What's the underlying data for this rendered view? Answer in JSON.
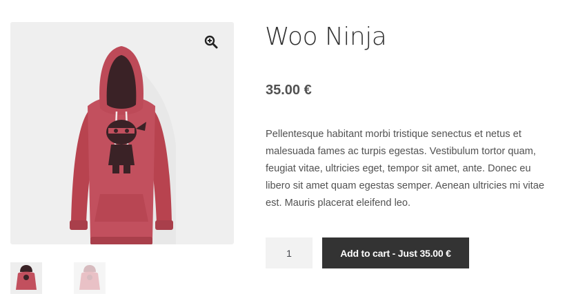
{
  "gallery": {
    "main_image_alt": "Woo Ninja hoodie",
    "zoom_icon": "zoom-in-icon",
    "thumbnails": [
      {
        "icon": "hoodie-thumbnail-red"
      },
      {
        "icon": "hoodie-thumbnail-pink"
      }
    ]
  },
  "product": {
    "title": "Woo Ninja",
    "price": "35.00 €",
    "description": "Pellentesque habitant morbi tristique senectus et netus et malesuada fames ac turpis egestas. Vestibulum tortor quam, feugiat vitae, ultricies eget, tempor sit amet, ante. Donec eu libero sit amet quam egestas semper. Aenean ultricies mi vitae est. Mauris placerat eleifend leo."
  },
  "cart": {
    "quantity": "1",
    "button_label": "Add to cart - Just 35.00 €"
  },
  "colors": {
    "button_bg": "#333333",
    "hoodie": "#c2505e",
    "image_bg": "#efefef"
  }
}
